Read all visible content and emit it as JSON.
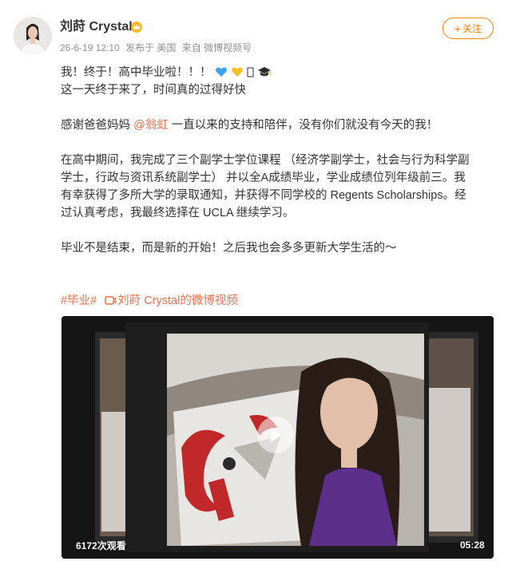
{
  "author": {
    "name": "刘莳 Crystal",
    "badge_icon": "gold-crown-icon"
  },
  "meta": {
    "timestamp": "26-6-19 12:10",
    "location": "发布于 美国",
    "source": "来自 微博视频号"
  },
  "follow_button": {
    "label": "关注",
    "icon": "plus-icon"
  },
  "post": {
    "line1": "我！终于！高中毕业啦！！！",
    "line2": "这一天终于来了，时间真的过得好快",
    "thanks_prefix": "感谢爸爸妈妈 ",
    "mention": "@翁虹",
    "thanks_suffix": " 一直以来的支持和陪伴，没有你们就没有今天的我！",
    "para_school_1": "在高中期间，我完成了三个副学士学位课程 （经济学副学士，社会与行为科学副",
    "para_school_2": "学士，行政与资讯系统副学士） 并以全A成绩毕业，学业成绩位列年级前三。我",
    "para_school_3": "有幸获得了多所大学的录取通知，并获得不同学校的 Regents Scholarships。经",
    "para_school_4": "过认真考虑，我最终选择在 UCLA 继续学习。",
    "closing": "毕业不是结束，而是新的开始！之后我也会多多更新大学生活的～"
  },
  "topics": {
    "hashtag": "#毕业#",
    "video_link": "刘莳 Crystal的微博视频"
  },
  "video": {
    "views": "6172次观看",
    "duration": "05:28"
  },
  "colors": {
    "accent_orange": "#ff8200",
    "link": "#eb7350",
    "meta_gray": "#939393",
    "text": "#333333"
  }
}
